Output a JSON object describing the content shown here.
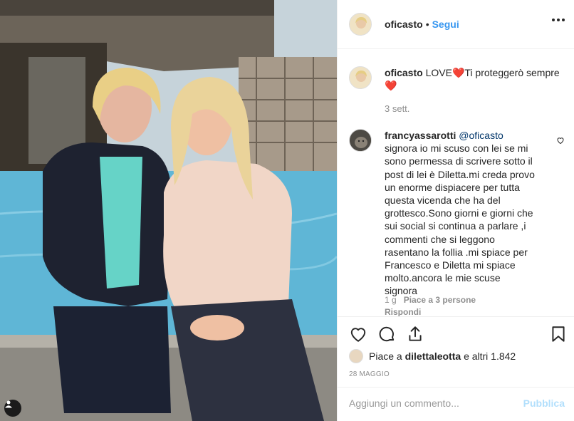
{
  "header": {
    "username": "oficasto",
    "separator": "•",
    "follow_label": "Segui",
    "more_icon": "more-horizontal-icon"
  },
  "caption": {
    "username": "oficasto",
    "text_part1": "LOVE",
    "text_part2": "Ti proteggerò sempre",
    "heart_glyph": "❤️",
    "time": "3 sett."
  },
  "comment": {
    "username": "francyassarotti",
    "mention": "@oficasto",
    "text": "signora io mi scuso con lei se mi sono permessa di scrivere sotto il post di lei è Diletta.mi creda provo un enorme dispiacere per tutta questa vicenda che ha del grottesco.Sono giorni e giorni che sui social si continua a parlare ,i commenti che si leggono rasentano la follia .mi spiace per Francesco e Diletta mi spiace molto.ancora le mie scuse signora",
    "time": "1 g",
    "likes": "Piace a 3 persone",
    "reply_label": "Rispondi"
  },
  "likers": {
    "prefix": "Piace a",
    "user": "dilettaleotta",
    "suffix": "e altri 1.842"
  },
  "date": "28 MAGGIO",
  "composer": {
    "placeholder": "Aggiungi un commento...",
    "publish_label": "Pubblica"
  },
  "colors": {
    "link": "#3897f0",
    "publish_disabled": "#b2dffc",
    "heart": "#e0245e",
    "muted": "#8e8e8e"
  }
}
